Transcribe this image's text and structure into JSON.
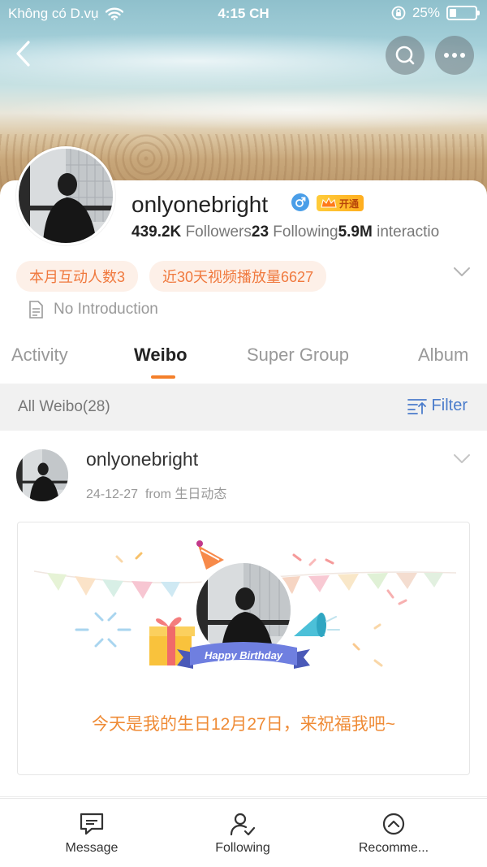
{
  "status_bar": {
    "carrier": "Không có D.vụ",
    "time": "4:15 CH",
    "battery": "25%",
    "battery_level": 0.25
  },
  "header": {
    "back_icon": "chevron-left-icon",
    "search_icon": "search-icon",
    "more_icon": "more-dots-icon"
  },
  "profile": {
    "username": "onlyonebright",
    "gender_icon": "male-icon",
    "vip_label": "开通",
    "followers_count": "439.2K",
    "followers_label": "Followers",
    "following_count": "23",
    "following_label": "Following",
    "interactions_count": "5.9M",
    "interactions_label": "interactio",
    "tags": [
      "本月互动人数3",
      "近30天视频播放量6627"
    ],
    "intro": "No Introduction"
  },
  "tabs": [
    {
      "label": "Activity"
    },
    {
      "label": "Weibo",
      "active": true
    },
    {
      "label": "Super Group"
    },
    {
      "label": "Album"
    }
  ],
  "filter_bar": {
    "all_label": "All Weibo(28)",
    "filter_label": "Filter"
  },
  "post": {
    "username": "onlyonebright",
    "date": "24-12-27",
    "from_label": "from",
    "source": "生日动态",
    "banner_label": "Happy Birthday",
    "birthday_text": "今天是我的生日12月27日，来祝福我吧~"
  },
  "bottom_nav": [
    {
      "label": "Message",
      "icon": "message-icon"
    },
    {
      "label": "Following",
      "icon": "follow-user-icon"
    },
    {
      "label": "Recomme...",
      "icon": "recommend-icon"
    }
  ],
  "colors": {
    "accent_orange": "#f47f2a",
    "link_blue": "#4b7ccb",
    "tag_bg": "#fdf0e8",
    "tag_text": "#f0793e"
  }
}
